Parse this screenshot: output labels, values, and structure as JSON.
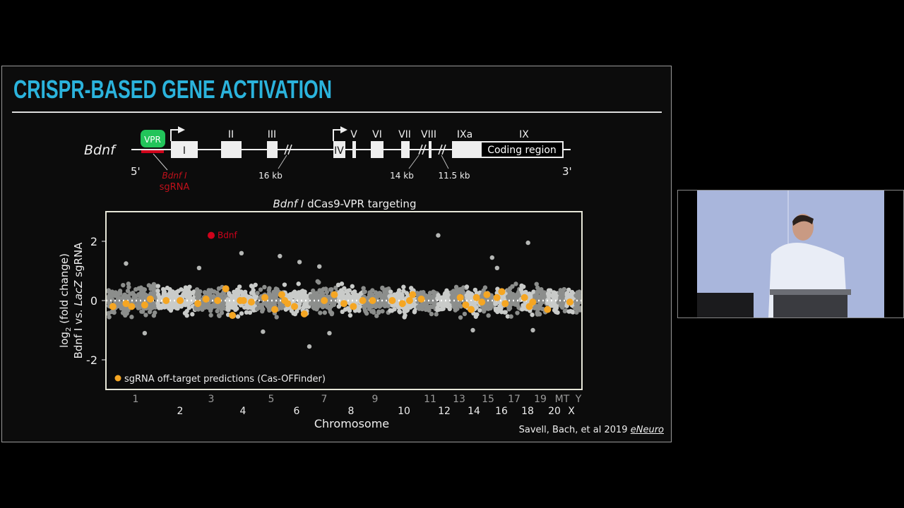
{
  "slide": {
    "title": "CRISPR-BASED GENE ACTIVATION",
    "citation": "Savell, Bach, et al 2019",
    "journal": "eNeuro"
  },
  "gene_diagram": {
    "gene": "Bdnf",
    "five_prime": "5'",
    "three_prime": "3'",
    "vpr": "VPR",
    "sgrna_label_1": "Bdnf I",
    "sgrna_label_2": "sgRNA",
    "exons": [
      "I",
      "II",
      "III",
      "IV",
      "V",
      "VI",
      "VII",
      "VIII",
      "IXa",
      "IX"
    ],
    "coding_region": "Coding region",
    "gaps": [
      "16 kb",
      "14 kb",
      "11.5 kb"
    ]
  },
  "chart_data": {
    "type": "scatter",
    "title": "Bdnf I dCas9-VPR targeting",
    "title_italic": "Bdnf I",
    "title_rest": " dCas9-VPR targeting",
    "xlabel": "Chromosome",
    "ylabel_line1": "log2 (fold change)",
    "ylabel_line2": "Bdnf I vs. LacZ sgRNA",
    "ylim": [
      -3,
      3
    ],
    "yticks": [
      2,
      0,
      -2
    ],
    "categories": [
      "1",
      "2",
      "3",
      "4",
      "5",
      "6",
      "7",
      "8",
      "9",
      "10",
      "11",
      "12",
      "13",
      "14",
      "15",
      "16",
      "17",
      "18",
      "19",
      "20",
      "MT",
      "X",
      "Y"
    ],
    "grid": false,
    "reference_line": 0,
    "highlight": {
      "label": "Bdnf",
      "chromosome": "3",
      "value": 2.2,
      "color": "#d0021b"
    },
    "outliers": [
      [
        "1",
        1.25
      ],
      [
        "1",
        -1.1
      ],
      [
        "3",
        1.1
      ],
      [
        "4",
        1.6
      ],
      [
        "5",
        1.5
      ],
      [
        "5",
        -1.05
      ],
      [
        "6",
        1.3
      ],
      [
        "6",
        -1.55
      ],
      [
        "7",
        1.15
      ],
      [
        "7",
        -1.1
      ],
      [
        "12",
        2.2
      ],
      [
        "14",
        -1.0
      ],
      [
        "15",
        1.45
      ],
      [
        "16",
        1.1
      ],
      [
        "18",
        1.95
      ],
      [
        "18",
        -1.0
      ]
    ],
    "off_target": [
      [
        "1",
        -0.1
      ],
      [
        "1",
        -0.15
      ],
      [
        "1",
        -0.2
      ],
      [
        "1",
        -0.2
      ],
      [
        "1",
        0.05
      ],
      [
        "2",
        0
      ],
      [
        "2",
        0
      ],
      [
        "3",
        0.4
      ],
      [
        "3",
        0.05
      ],
      [
        "3",
        0
      ],
      [
        "3",
        -0.1
      ],
      [
        "4",
        0
      ],
      [
        "4",
        -0.05
      ],
      [
        "4",
        -0.5
      ],
      [
        "4",
        0
      ],
      [
        "5",
        0.2
      ],
      [
        "5",
        0.1
      ],
      [
        "5",
        -0.3
      ],
      [
        "6",
        0
      ],
      [
        "6",
        -0.2
      ],
      [
        "6",
        -0.45
      ],
      [
        "6",
        -0.1
      ],
      [
        "7",
        0
      ],
      [
        "7",
        0.2
      ],
      [
        "8",
        -0.1
      ],
      [
        "8",
        -0.2
      ],
      [
        "8",
        0
      ],
      [
        "9",
        0
      ],
      [
        "10",
        0
      ],
      [
        "10",
        0
      ],
      [
        "10",
        -0.1
      ],
      [
        "10",
        0.2
      ],
      [
        "11",
        0.05
      ],
      [
        "13",
        0.1
      ],
      [
        "13",
        -0.15
      ],
      [
        "14",
        -0.3
      ],
      [
        "14",
        0.1
      ],
      [
        "15",
        -0.05
      ],
      [
        "15",
        0.2
      ],
      [
        "16",
        -0.1
      ],
      [
        "16",
        0.1
      ],
      [
        "16",
        0.3
      ],
      [
        "18",
        -0.05
      ],
      [
        "18",
        0.1
      ],
      [
        "18",
        -0.2
      ],
      [
        "20",
        -0.3
      ],
      [
        "X",
        -0.05
      ]
    ],
    "legend": {
      "label": "sgRNA off-target predictions (Cas-OFFinder)",
      "placement": "bottom-left"
    },
    "colors": {
      "off_target": "#f5a623",
      "band_dark": "#8c8e8c",
      "band_light": "#c9cbc9",
      "highlight": "#d0021b"
    }
  },
  "webcam": {
    "description_free": true
  }
}
